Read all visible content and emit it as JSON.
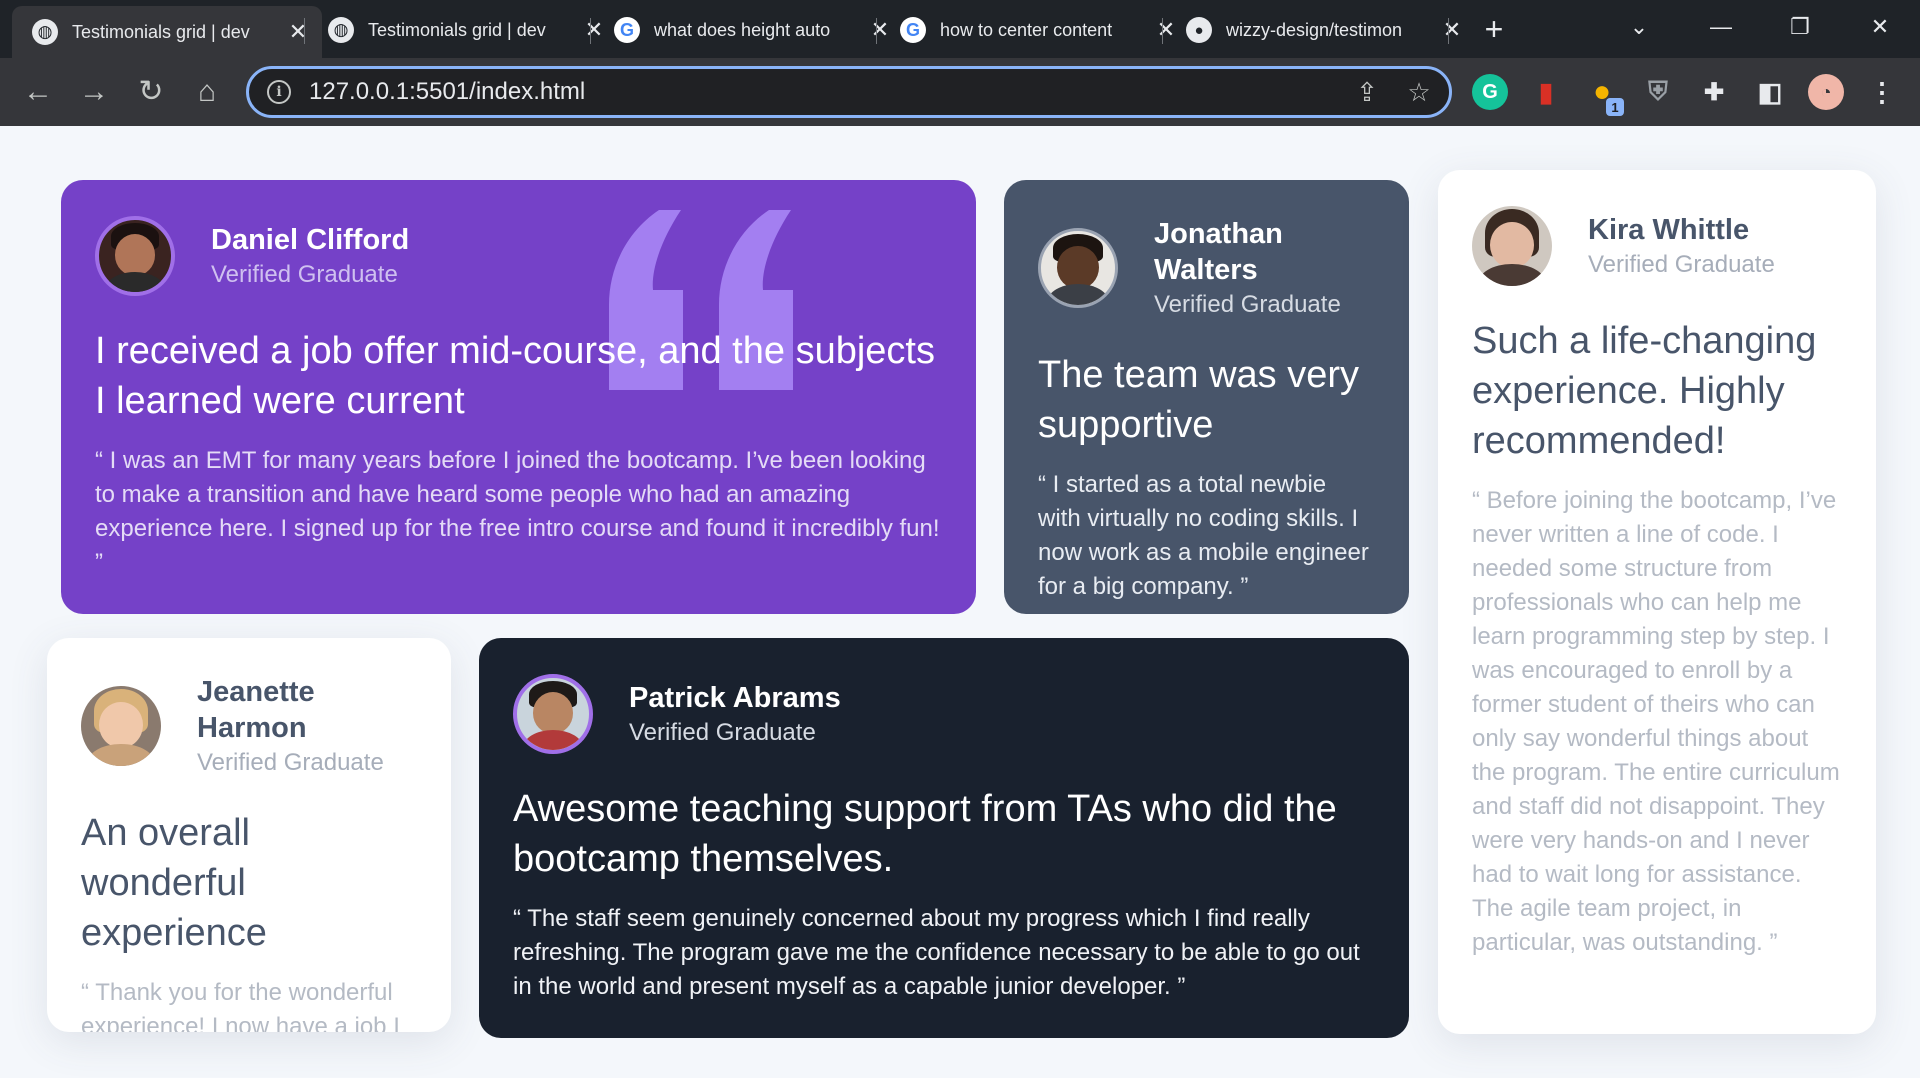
{
  "browser": {
    "tabs": [
      {
        "title": "Testimonials grid | dev",
        "favicon": "globe-icon",
        "active": true
      },
      {
        "title": "Testimonials grid | dev",
        "favicon": "globe-icon",
        "active": false
      },
      {
        "title": "what does height auto",
        "favicon": "google-icon",
        "active": false
      },
      {
        "title": "how to center content",
        "favicon": "google-icon",
        "active": false
      },
      {
        "title": "wizzy-design/testimon",
        "favicon": "github-icon",
        "active": false
      }
    ],
    "url": "127.0.0.1:5501/index.html",
    "extensions": [
      {
        "name": "grammarly-icon",
        "glyph": "G",
        "color": "#15c39a"
      },
      {
        "name": "bookmark-extension-icon",
        "glyph": "▮",
        "color": "#d93025"
      },
      {
        "name": "cookie-extension-icon",
        "glyph": "●",
        "color": "#f4b400",
        "badge": "1"
      },
      {
        "name": "shield-extension-icon",
        "glyph": "⛨",
        "color": "#9aa0a6"
      },
      {
        "name": "puzzle-extensions-icon",
        "glyph": "✚",
        "color": "#e8eaed"
      },
      {
        "name": "side-panel-icon",
        "glyph": "◧",
        "color": "#e8eaed"
      }
    ]
  },
  "colors": {
    "violet": "#7541c8",
    "grayish_blue": "#48556a",
    "dark_blue": "#19212e",
    "white": "#ffffff",
    "page_bg": "#f4f7fb"
  },
  "testimonials": [
    {
      "name": "Daniel Clifford",
      "role": "Verified Graduate",
      "headline": "I received a job offer mid-course, and the subjects I learned were current",
      "quote": "“ I was an EMT for many years before I joined the bootcamp. I’ve been looking to make a transition and have heard some people who had an amazing experience here. I signed up for the free intro course and found it incredibly fun! ”"
    },
    {
      "name": "Jonathan Walters",
      "role": "Verified Graduate",
      "headline": "The team was very supportive",
      "quote": "“ I started as a total newbie with virtually no coding skills. I now work as a mobile engineer for a big company. ”"
    },
    {
      "name": "Kira Whittle",
      "role": "Verified Graduate",
      "headline": "Such a life-changing experience. Highly recommended!",
      "quote": "“ Before joining the bootcamp, I’ve never written a line of code. I needed some structure from professionals who can help me learn programming step by step. I was encouraged to enroll by a former student of theirs who can only say wonderful things about the program. The entire curriculum and staff did not disappoint. They were very hands-on and I never had to wait long for assistance. The agile team project, in particular, was outstanding. ”"
    },
    {
      "name": "Jeanette Harmon",
      "role": "Verified Graduate",
      "headline": "An overall wonderful experience",
      "quote": "“ Thank you for the wonderful experience! I now have a job I really enjoy ”"
    },
    {
      "name": "Patrick Abrams",
      "role": "Verified Graduate",
      "headline": "Awesome teaching support from TAs who did the bootcamp themselves.",
      "quote": "“ The staff seem genuinely concerned about my progress which I find really refreshing. The program gave me the confidence necessary to be able to go out in the world and present myself as a capable junior developer. ”"
    }
  ]
}
